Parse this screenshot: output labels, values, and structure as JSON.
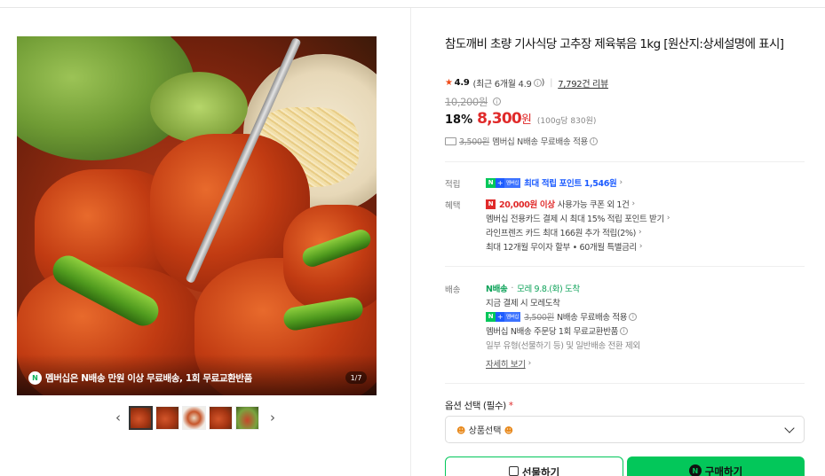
{
  "gallery": {
    "caption": "멤버십은 N배송 만원 이상 무료배송, 1회 무료교환반품",
    "caption_badge": "N",
    "pager": "1/7",
    "thumbnail_count": 5
  },
  "product": {
    "title": "참도깨비 초량 기사식당 고추장 제육볶음 1kg [원산지:상세설명에 표시]",
    "rating": {
      "score": "4.9",
      "recent": "(최근 6개월 4.9",
      "recent_close": ")",
      "reviews": "7,792건 리뷰"
    },
    "price": {
      "original": "10,200원",
      "discount": "18%",
      "sale": "8,300",
      "currency": "원",
      "unit_price": "(100g당 830원)"
    },
    "shipping_summary": {
      "struck_fee": "3,500원",
      "text": "멤버십 N배송 무료배송 적용"
    }
  },
  "points": {
    "label": "적립",
    "badge_plus": "+",
    "badge_member": "멤버십",
    "text": "최대 적립 포인트 1,546원"
  },
  "benefits": {
    "label": "혜택",
    "coupon_bold": "20,000원 이상",
    "coupon_text": "사용가능 쿠폰 외 1건",
    "items": [
      "멤버십 전용카드 결제 시 최대 15% 적립 포인트 받기",
      "라인프렌즈 카드 최대 166원 추가 적립(2%)",
      "최대 12개월 무이자 할부 • 60개월 특별금리"
    ]
  },
  "delivery": {
    "label": "배송",
    "brand": "N배송",
    "eta": "모레 9.8.(화) 도착",
    "pay_now": "지금 결제 시 모레도착",
    "struck_fee": "3,500원",
    "free_text": "N배송 무료배송 적용",
    "member_exchange": "멤버십 N배송 주문당 1회 무료교환반품",
    "exception": "일부 유형(선물하기 등) 및 일반배송 전환 제외",
    "more": "자세히 보기"
  },
  "options": {
    "label": "옵션 선택 (필수)",
    "required_mark": "*",
    "select_value": "상품선택"
  },
  "buttons": {
    "gift": "선물하기",
    "buy": "구매하기"
  },
  "colors": {
    "naver_green": "#03c75a",
    "sale_red": "#e02a2a",
    "member_blue": "#1d5cff"
  }
}
